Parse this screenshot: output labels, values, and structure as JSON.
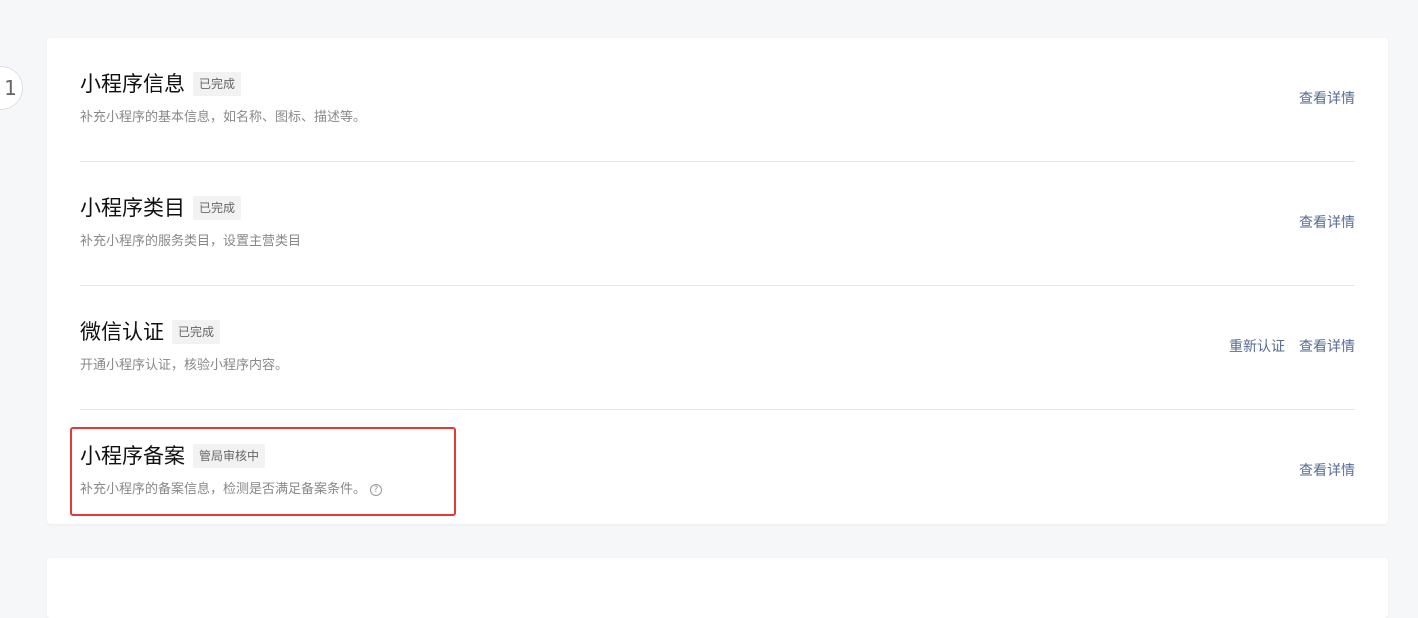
{
  "step": {
    "number": "1"
  },
  "items": [
    {
      "title": "小程序信息",
      "status": "已完成",
      "description": "补充小程序的基本信息，如名称、图标、描述等。",
      "actions": [
        "查看详情"
      ]
    },
    {
      "title": "小程序类目",
      "status": "已完成",
      "description": "补充小程序的服务类目，设置主营类目",
      "actions": [
        "查看详情"
      ]
    },
    {
      "title": "微信认证",
      "status": "已完成",
      "description": "开通小程序认证，核验小程序内容。",
      "actions": [
        "重新认证",
        "查看详情"
      ]
    },
    {
      "title": "小程序备案",
      "status": "管局审核中",
      "description": "补充小程序的备案信息，检测是否满足备案条件。",
      "help_icon": "question-circle-icon",
      "actions": [
        "查看详情"
      ]
    }
  ],
  "colors": {
    "link": "#576b95",
    "highlight": "#e53935",
    "background": "#f6f7f9"
  }
}
